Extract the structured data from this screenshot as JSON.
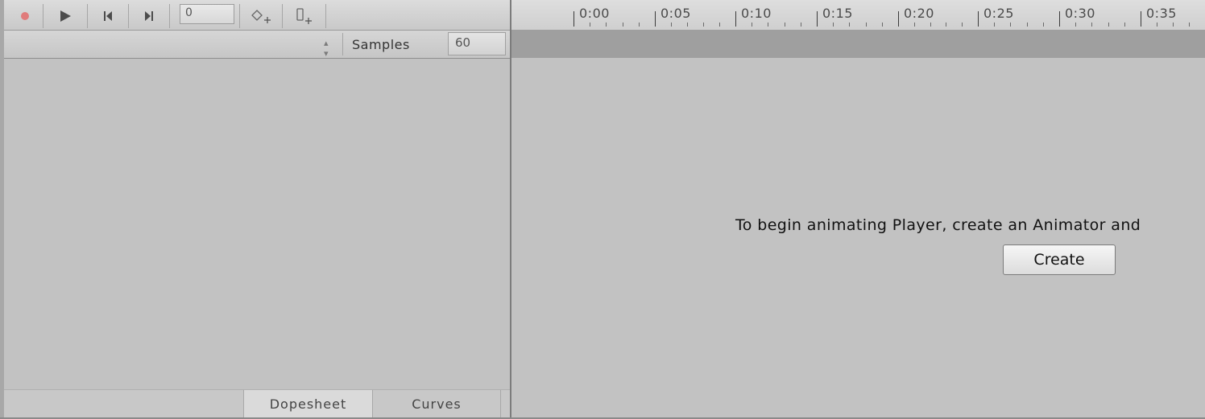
{
  "toolbar": {
    "record_icon": "record-icon",
    "play_icon": "play-icon",
    "prev_key_icon": "previous-keyframe-icon",
    "next_key_icon": "next-keyframe-icon",
    "frame_value": "0",
    "add_keyframe_icon": "add-keyframe-icon",
    "add_event_icon": "add-event-icon",
    "colors": {
      "record": "#e07b7b"
    }
  },
  "clip_row": {
    "selector_icon": "clip-selector-arrows-icon",
    "samples_label": "Samples",
    "samples_value": "60"
  },
  "timeline": {
    "ticks": [
      "0:00",
      "0:05",
      "0:10",
      "0:15",
      "0:20",
      "0:25",
      "0:30",
      "0:35"
    ]
  },
  "content": {
    "message": "To begin animating Player, create an Animator and",
    "create_label": "Create"
  },
  "tabs": {
    "dopesheet": "Dopesheet",
    "curves": "Curves"
  }
}
